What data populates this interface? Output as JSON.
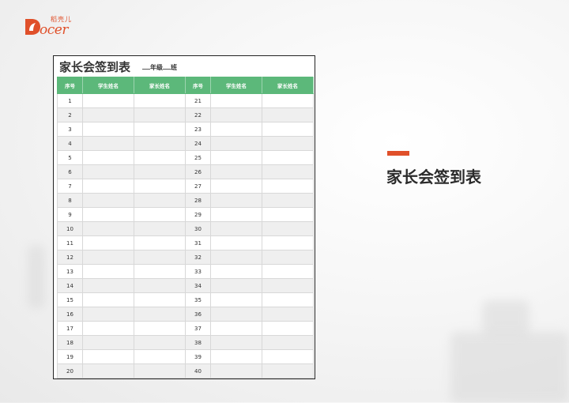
{
  "logo": {
    "brand_text": "ocer",
    "brand_cn": "稻壳儿"
  },
  "sheet": {
    "title": "家长会签到表",
    "class_line": {
      "grade": "年级",
      "class": "班"
    },
    "headers": [
      "序号",
      "学生姓名",
      "家长姓名",
      "序号",
      "学生姓名",
      "家长姓名"
    ],
    "rows": [
      [
        "1",
        "21"
      ],
      [
        "2",
        "22"
      ],
      [
        "3",
        "23"
      ],
      [
        "4",
        "24"
      ],
      [
        "5",
        "25"
      ],
      [
        "6",
        "26"
      ],
      [
        "7",
        "27"
      ],
      [
        "8",
        "28"
      ],
      [
        "9",
        "29"
      ],
      [
        "10",
        "30"
      ],
      [
        "11",
        "31"
      ],
      [
        "12",
        "32"
      ],
      [
        "13",
        "33"
      ],
      [
        "14",
        "34"
      ],
      [
        "15",
        "35"
      ],
      [
        "16",
        "36"
      ],
      [
        "17",
        "37"
      ],
      [
        "18",
        "38"
      ],
      [
        "19",
        "39"
      ],
      [
        "20",
        "40"
      ]
    ]
  },
  "right_panel": {
    "title": "家长会签到表",
    "accent_color": "#e0502a"
  },
  "colors": {
    "header_green": "#5cb87a",
    "brand_orange": "#e0502a"
  }
}
